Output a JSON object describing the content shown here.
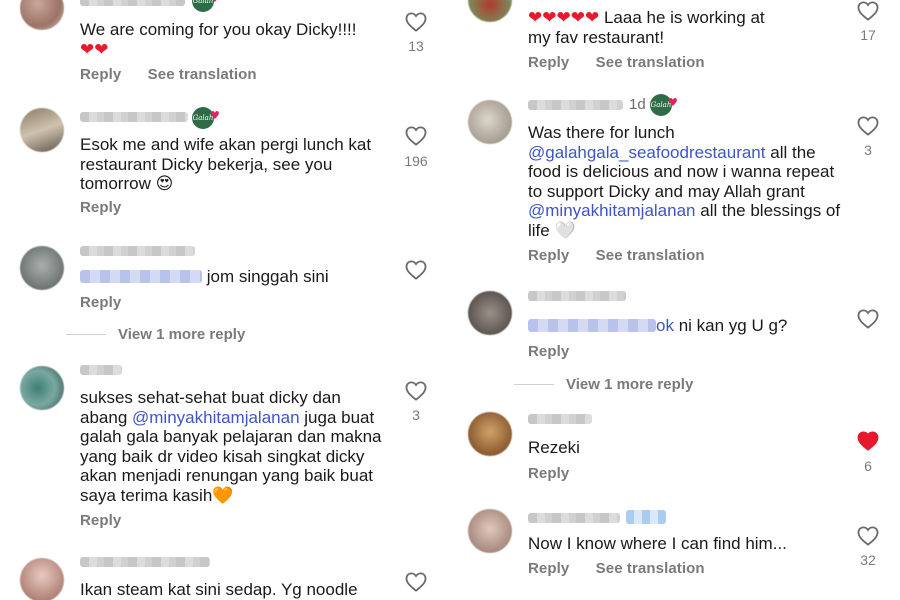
{
  "left": {
    "c1": {
      "text_line1": "We are coming for you okay Dicky!!!!",
      "emoji": "❤❤",
      "likes": "13",
      "reply": "Reply",
      "see_translation": "See translation"
    },
    "c2": {
      "text": "Esok me and wife akan pergi lunch kat restaurant Dicky bekerja, see you tomorrow",
      "emoji": "😍",
      "likes": "196",
      "reply": "Reply"
    },
    "c3": {
      "text": "jom singgah sini",
      "reply": "Reply"
    },
    "view_more": "View 1 more reply",
    "c4": {
      "text_a": "sukses sehat-sehat buat dicky dan abang",
      "mention": "@minyakhitamjalanan",
      "text_b": "juga buat galah gala banyak pelajaran dan makna yang baik dr video kisah singkat dicky akan menjadi renungan yang baik buat saya terima kasih",
      "emoji": "🧡",
      "likes": "3",
      "reply": "Reply"
    },
    "c5": {
      "text": "Ikan steam kat sini sedap. Yg noodle"
    }
  },
  "right": {
    "c1": {
      "emoji": "❤❤❤❤❤",
      "text_a": "Laaa he is working at",
      "text_b": "my fav restaurant!",
      "likes": "17",
      "reply": "Reply",
      "see_translation": "See translation"
    },
    "c2": {
      "time": "1d",
      "text_a": "Was there for lunch",
      "mention1": "@galahgala_seafoodrestaurant",
      "text_b": "all the food is delicious and now i wanna repeat to support Dicky and may Allah grant",
      "mention2": "@minyakhitamjalanan",
      "text_c": "all the blessings of life",
      "emoji": "🤍",
      "likes": "3",
      "reply": "Reply",
      "see_translation": "See translation"
    },
    "c3": {
      "mention_tail": "ok",
      "text": "ni kan yg U g?",
      "reply": "Reply"
    },
    "view_more": "View 1 more reply",
    "c4": {
      "text": "Rezeki",
      "likes": "6",
      "reply": "Reply"
    },
    "c5": {
      "text": "Now I know where I can find him...",
      "likes": "32",
      "reply": "Reply",
      "see_translation": "See translation"
    }
  },
  "colors": {
    "mention": "#3d56c4",
    "liked_heart": "#e0245e",
    "badge": "#2f6b45"
  },
  "icons": {
    "like": "heart-outline-icon",
    "liked": "heart-filled-icon",
    "badge": "verified-brand-badge-icon"
  }
}
